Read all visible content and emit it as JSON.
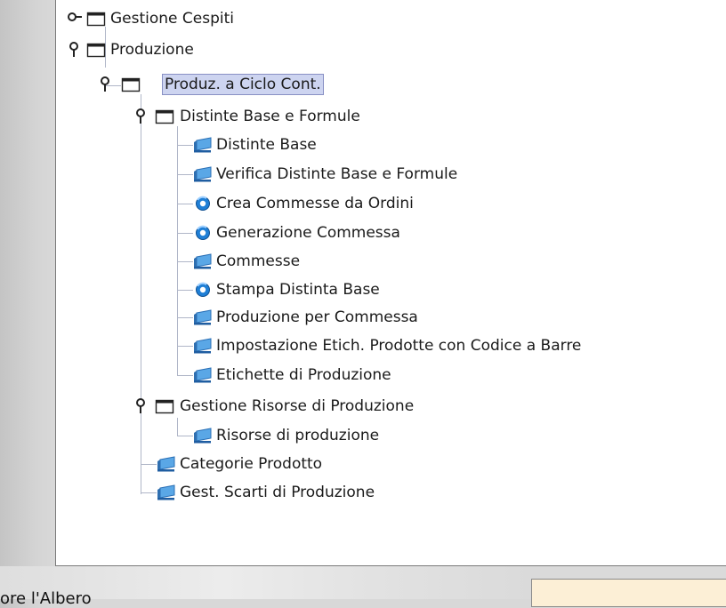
{
  "tree": {
    "nodes": [
      {
        "label": "Gestione Cespiti",
        "type": "folder",
        "expanded": false
      },
      {
        "label": "Produzione",
        "type": "folder",
        "expanded": true
      },
      {
        "label": "Produz. a Ciclo Cont.",
        "type": "folder",
        "expanded": true,
        "selected": true
      },
      {
        "label": "Distinte Base e Formule",
        "type": "folder",
        "expanded": true
      },
      {
        "label": "Distinte Base",
        "type": "form"
      },
      {
        "label": "Verifica Distinte Base e Formule",
        "type": "form"
      },
      {
        "label": "Crea Commesse da Ordini",
        "type": "process"
      },
      {
        "label": "Generazione Commessa",
        "type": "process"
      },
      {
        "label": "Commesse",
        "type": "form"
      },
      {
        "label": "Stampa Distinta Base",
        "type": "process"
      },
      {
        "label": "Produzione per Commessa",
        "type": "form"
      },
      {
        "label": "Impostazione Etich. Prodotte con Codice a Barre",
        "type": "form"
      },
      {
        "label": "Etichette di Produzione",
        "type": "form"
      },
      {
        "label": "Gestione Risorse di Produzione",
        "type": "folder",
        "expanded": true
      },
      {
        "label": "Risorse di produzione",
        "type": "form"
      },
      {
        "label": "Categorie Prodotto",
        "type": "form"
      },
      {
        "label": "Gest. Scarti di Produzione",
        "type": "form"
      }
    ]
  },
  "footer": {
    "label": "ore l'Albero"
  },
  "colors": {
    "selection_bg": "#cdd4f0",
    "selection_border": "#8890c4",
    "tree_line": "#b0b6c8",
    "field_bg": "#fcefd6"
  }
}
